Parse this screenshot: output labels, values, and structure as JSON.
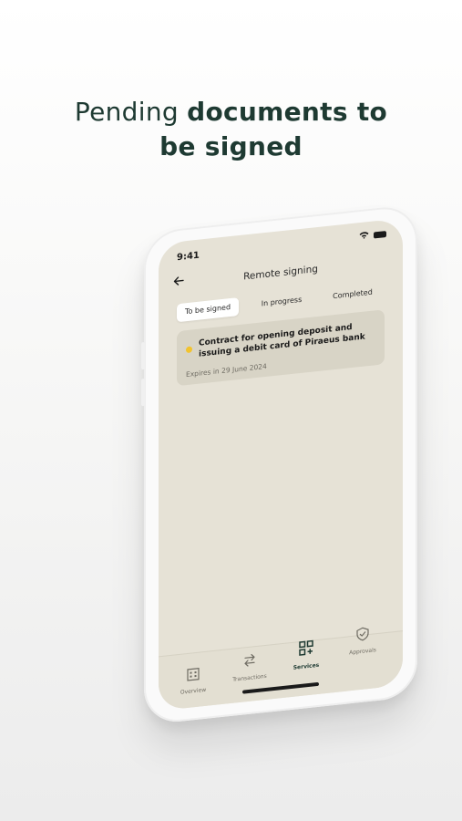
{
  "headline": {
    "light": "Pending ",
    "bold_1": "documents to",
    "bold_2": "be signed"
  },
  "status_bar": {
    "time": "9:41"
  },
  "header": {
    "title": "Remote signing"
  },
  "tabs": [
    {
      "label": "To be signed",
      "active": true
    },
    {
      "label": "In progress",
      "active": false
    },
    {
      "label": "Completed",
      "active": false
    }
  ],
  "documents": [
    {
      "title": "Contract for opening deposit and issuing a debit card of Piraeus bank",
      "expires": "Expires in 29 June 2024",
      "status_color": "#f2c32e"
    }
  ],
  "bottom_nav": [
    {
      "label": "Overview",
      "icon": "bank-icon",
      "active": false
    },
    {
      "label": "Transactions",
      "icon": "transfer-arrows-icon",
      "active": false
    },
    {
      "label": "Services",
      "icon": "grid-plus-icon",
      "active": true
    },
    {
      "label": "Approvals",
      "icon": "shield-check-icon",
      "active": false
    }
  ],
  "colors": {
    "brand_dark": "#1e3a32",
    "screen_bg": "#e6e2d6",
    "card_bg": "#d8d4c6",
    "pending": "#f2c32e"
  }
}
